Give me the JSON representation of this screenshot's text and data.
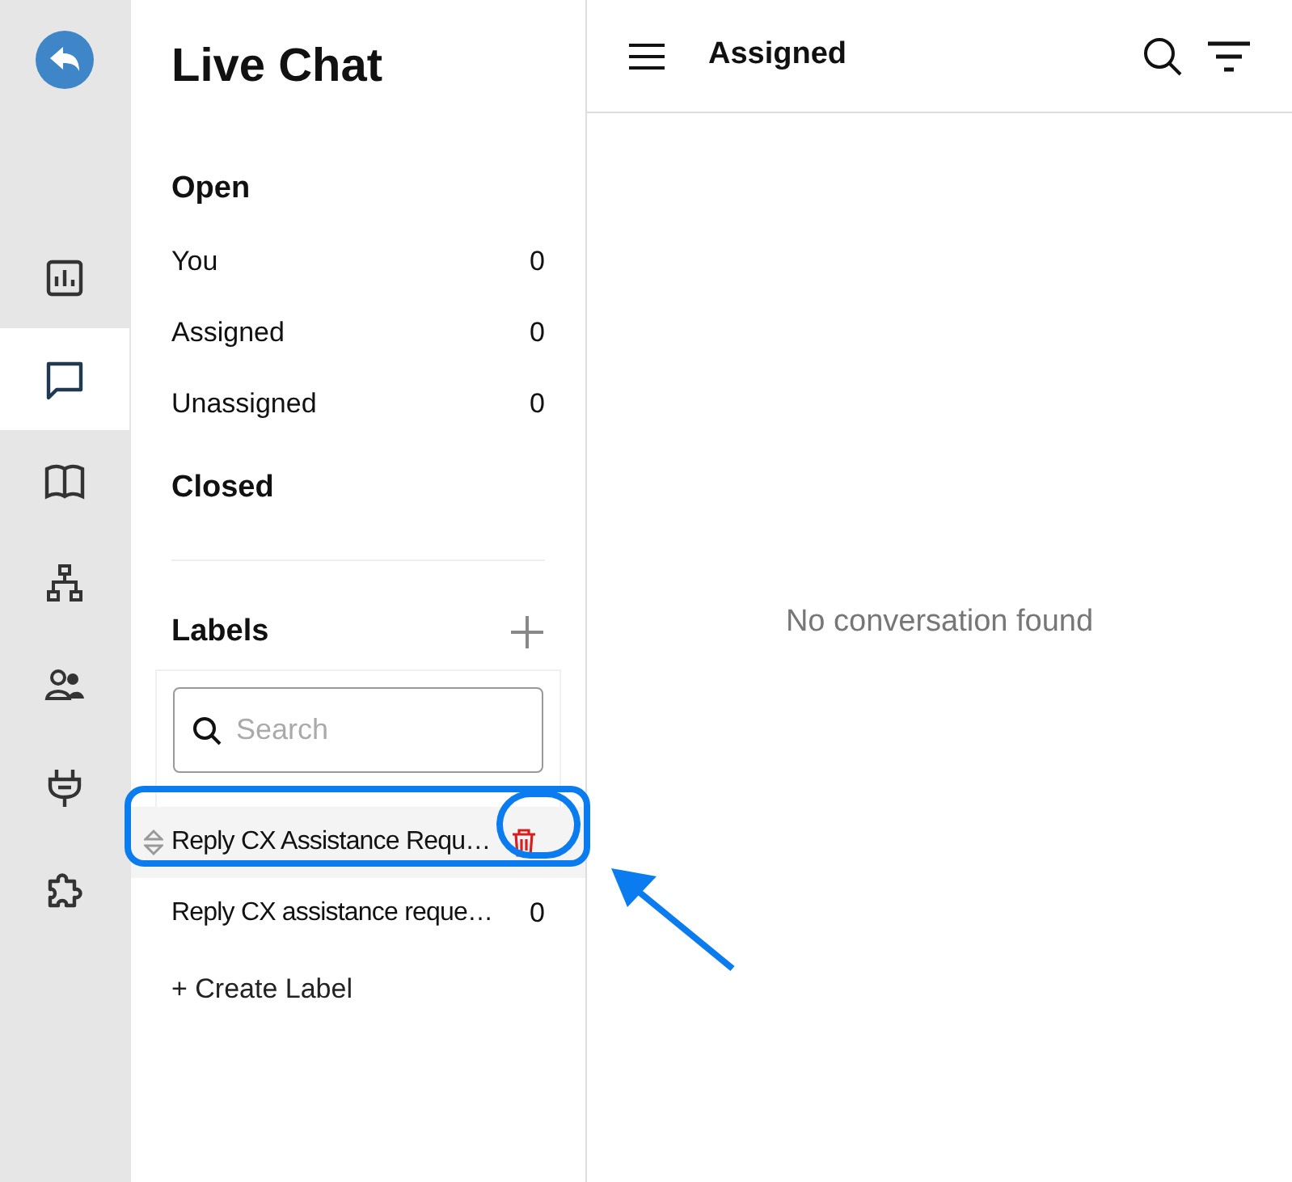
{
  "rail": {
    "items": [
      {
        "selected": false
      },
      {
        "selected": true
      },
      {
        "selected": false
      },
      {
        "selected": false
      },
      {
        "selected": false
      },
      {
        "selected": false
      },
      {
        "selected": false
      }
    ]
  },
  "panel": {
    "title": "Live Chat",
    "open_heading": "Open",
    "open_items": [
      {
        "label": "You",
        "count": "0"
      },
      {
        "label": "Assigned",
        "count": "0"
      },
      {
        "label": "Unassigned",
        "count": "0"
      }
    ],
    "closed_heading": "Closed",
    "labels_heading": "Labels",
    "search": {
      "placeholder": "Search"
    },
    "labels": [
      {
        "name": "Reply CX Assistance Requ…",
        "selected": true
      },
      {
        "name": "Reply CX assistance reque…",
        "count": "0",
        "selected": false
      }
    ],
    "create_label": "+ Create Label"
  },
  "main": {
    "title": "Assigned",
    "empty_message": "No conversation found"
  }
}
